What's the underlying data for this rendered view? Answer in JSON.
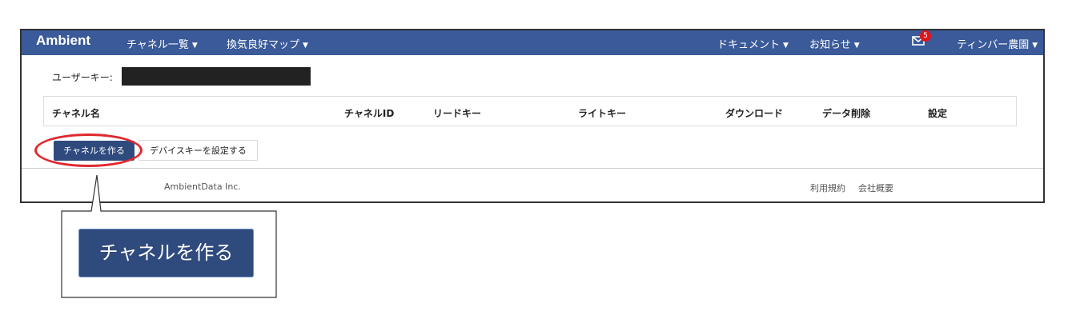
{
  "navbar": {
    "brand": "Ambient",
    "channel_list": "チャネル一覧",
    "ventilation_map": "換気良好マップ",
    "documents": "ドキュメント",
    "notices": "お知らせ",
    "mail_badge": "5",
    "user": "ティンバー農園",
    "color": "#3a5a99"
  },
  "user_key": {
    "label": "ユーザーキー:"
  },
  "table": {
    "headers": [
      "チャネル名",
      "チャネルID",
      "リードキー",
      "ライトキー",
      "ダウンロード",
      "データ削除",
      "設定"
    ]
  },
  "buttons": {
    "create_channel": "チャネルを作る",
    "set_device_key": "デバイスキーを設定する"
  },
  "footer": {
    "company": "AmbientData Inc.",
    "terms": "利用規約",
    "about": "会社概要"
  },
  "callout": {
    "zoom_label": "チャネルを作る"
  },
  "colors": {
    "highlight": "#e0282e",
    "primary_button": "#2f4a7d"
  }
}
